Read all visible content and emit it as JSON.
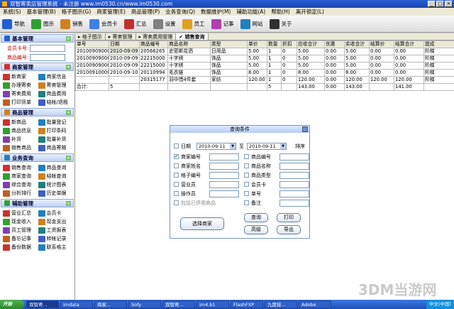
{
  "window": {
    "title": "双智寄卖店管理系统 - 未注册 www.im0530.cn/www.im0530.com"
  },
  "menu": [
    "系统(S)",
    "基本管理(B)",
    "格子图示(G)",
    "商家管理(E)",
    "商品管理(P)",
    "业务查询(Q)",
    "数据维护(M)",
    "辅助功能(A)",
    "帮助(H)",
    "离开锁定(L)"
  ],
  "toolbar": [
    {
      "label": "导航",
      "icon": "navigation-icon",
      "color": "#2060d0"
    },
    {
      "label": "图示",
      "icon": "grid-icon",
      "color": "#30a030"
    },
    {
      "label": "销售",
      "icon": "sales-icon",
      "color": "#d08020"
    },
    {
      "label": "会员卡",
      "icon": "member-card-icon",
      "color": "#4080e0"
    },
    {
      "label": "汇总",
      "icon": "summary-icon",
      "color": "#c03030"
    },
    {
      "label": "设置",
      "icon": "settings-icon",
      "color": "#808080"
    },
    {
      "label": "员工",
      "icon": "staff-icon",
      "color": "#e0a020"
    },
    {
      "label": "记事",
      "icon": "notes-icon",
      "color": "#b040b0"
    },
    {
      "label": "网站",
      "icon": "website-icon",
      "color": "#2080c0"
    },
    {
      "label": "关于",
      "icon": "about-icon",
      "color": "#303030"
    }
  ],
  "sidebar": {
    "basic": {
      "title": "基本管理",
      "fields": [
        {
          "label": "会员卡号:"
        },
        {
          "label": "商品编号:"
        }
      ]
    },
    "merchant": {
      "title": "商家管理",
      "items": [
        "新商家",
        "商家信息",
        "办理寄卖",
        "寄卖管理",
        "寄卖费用",
        "商品费用",
        "打印货单",
        "结帐/退租"
      ]
    },
    "product": {
      "title": "商品管理",
      "items": [
        "新商品",
        "批量登记",
        "商品信息",
        "打印条码",
        "补货",
        "批量补货",
        "销售商品",
        "商品寄赔"
      ]
    },
    "query": {
      "title": "业务查询",
      "items": [
        "销售查询",
        "商品查询",
        "商家查询",
        "结帐查询",
        "综合查询",
        "统计图表",
        "分析排行",
        "历史单据"
      ]
    },
    "aux": {
      "title": "辅助管理",
      "items": [
        "营业汇总",
        "会员卡",
        "现金收入",
        "现金支出",
        "员工管理",
        "工资报表",
        "备忘记事",
        "转帐记录",
        "备份数据",
        "联系格主"
      ]
    }
  },
  "tabs": [
    "格子图示",
    "寄卖管理",
    "寄卖费用管理",
    "销售查询"
  ],
  "table": {
    "headers": [
      "单号",
      "日期",
      "商品编号",
      "商品名称",
      "类型",
      "单价",
      "数量",
      "折扣",
      "应收合计",
      "优惠",
      "实收合计",
      "结算价",
      "结算合计",
      "提成"
    ],
    "rows": [
      [
        "201009090001",
        "2010-09-09",
        "20566265",
        "史密斯花洒",
        "日用品",
        "5.00",
        "1",
        "0",
        "5.00",
        "0.00",
        "5.00",
        "0.00",
        "0.00",
        "阶梯"
      ],
      [
        "201009090002",
        "2010-09-09",
        "22215000",
        "十字绣",
        "饰品",
        "5.00",
        "1",
        "0",
        "5.00",
        "0.00",
        "5.00",
        "0.00",
        "0.00",
        "阶梯"
      ],
      [
        "201009090003",
        "2010-09-09",
        "22215000",
        "十字绣",
        "饰品",
        "5.00",
        "1",
        "0",
        "5.00",
        "0.00",
        "5.00",
        "0.00",
        "0.00",
        "阶梯"
      ],
      [
        "201009100001",
        "2010-09-10",
        "20110994",
        "毛衣链",
        "饰品",
        "8.00",
        "1",
        "0",
        "8.00",
        "0.00",
        "8.00",
        "0.00",
        "0.00",
        "阶梯"
      ],
      [
        "",
        "",
        "20315177",
        "羽中惜4件套",
        "家纺",
        "120.00",
        "1",
        "0",
        "120.00",
        "0.00",
        "120.00",
        "120.00",
        "120.00",
        "阶梯"
      ]
    ],
    "total": [
      "合计:",
      "5",
      "",
      "",
      "",
      "",
      "5",
      "",
      "143.00",
      "0.00",
      "143.00",
      "",
      "141.00",
      ""
    ]
  },
  "dialog": {
    "title": "查询条件",
    "date_label": "日期",
    "date_from": "2010-09-11",
    "to_label": "至",
    "date_to": "2010-09-11",
    "order_label": "排序",
    "left_fields": [
      "商家编号",
      "商家姓名",
      "格子编号",
      "营业员",
      "操作员"
    ],
    "right_fields": [
      "商品编号",
      "商品名称",
      "商品类型",
      "会员卡",
      "单号",
      "备注"
    ],
    "include_disabled": "包括已停用商品",
    "buttons": {
      "select": "选择商家",
      "query": "查询",
      "print": "打印",
      "advanced": "高级",
      "export": "导出"
    }
  },
  "taskbar": {
    "start": "开始",
    "tasks": [
      "双智寄...",
      "imdata",
      "商家...",
      "Sofy",
      "双智寄...",
      "im4.b1",
      "FlashFXP",
      "九度技...",
      "Adobe"
    ],
    "tray": "中文(中国)"
  },
  "watermark": "3DM当游网"
}
